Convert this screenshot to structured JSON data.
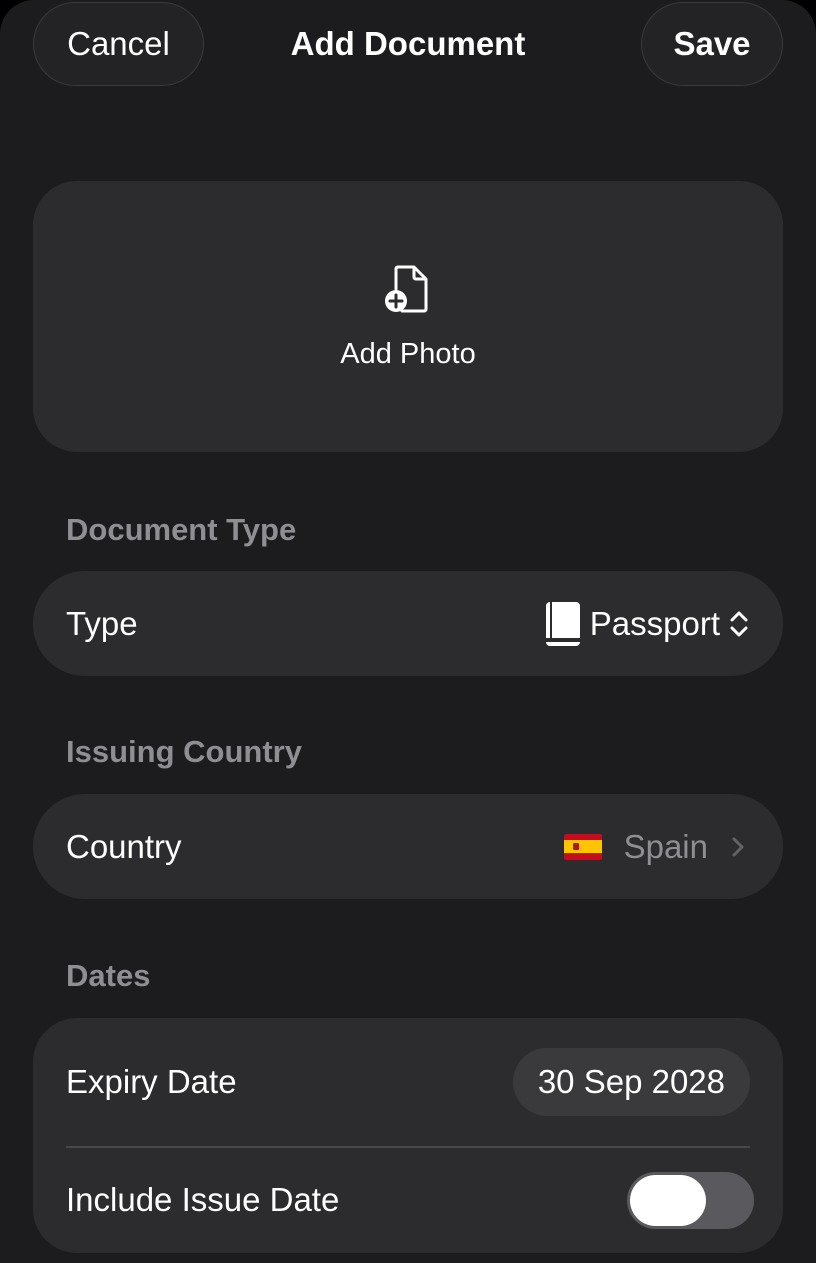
{
  "header": {
    "cancel_label": "Cancel",
    "title": "Add Document",
    "save_label": "Save"
  },
  "photo": {
    "icon": "document-plus-icon",
    "label": "Add Photo"
  },
  "document_type": {
    "section_header": "Document Type",
    "row_label": "Type",
    "value": "Passport",
    "value_icon": "passport-book-icon",
    "control_icon": "up-down-chevron-icon"
  },
  "issuing_country": {
    "section_header": "Issuing Country",
    "row_label": "Country",
    "value": "Spain",
    "flag_icon": "spain-flag-icon",
    "control_icon": "chevron-right-icon"
  },
  "dates": {
    "section_header": "Dates",
    "expiry_label": "Expiry Date",
    "expiry_value": "30 Sep 2028",
    "issue_label": "Include Issue Date",
    "issue_toggle_on": false
  },
  "colors": {
    "background": "#1c1c1e",
    "card": "#2c2c2e",
    "secondary_text": "#8e8e93",
    "pill": "#3a3a3c"
  }
}
